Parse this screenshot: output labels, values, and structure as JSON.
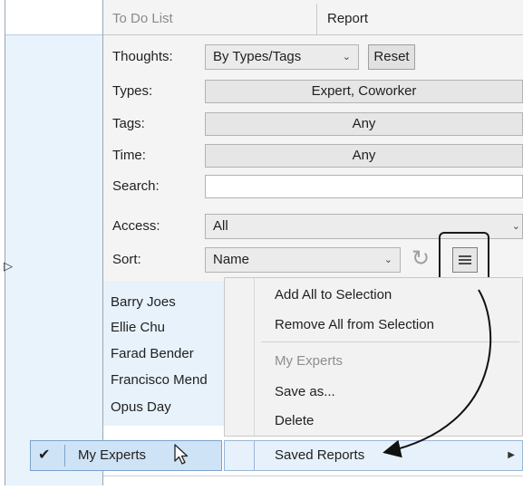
{
  "tabs": {
    "todo": "To Do List",
    "report": "Report"
  },
  "thoughts": {
    "label": "Thoughts:",
    "value": "By Types/Tags",
    "reset": "Reset"
  },
  "types": {
    "label": "Types:",
    "value": "Expert, Coworker"
  },
  "tags": {
    "label": "Tags:",
    "value": "Any"
  },
  "time": {
    "label": "Time:",
    "value": "Any"
  },
  "search": {
    "label": "Search:",
    "value": ""
  },
  "access": {
    "label": "Access:",
    "value": "All"
  },
  "sort": {
    "label": "Sort:",
    "value": "Name"
  },
  "people": [
    "Barry Joes",
    "Ellie Chu",
    "Farad Bender",
    "Francisco Mend",
    "Opus Day"
  ],
  "menu": {
    "add_all": "Add All to Selection",
    "remove_all": "Remove All from Selection",
    "my_experts": "My Experts",
    "save_as": "Save as...",
    "delete": "Delete",
    "saved_reports": "Saved Reports"
  },
  "saved_report_item": "My Experts",
  "colors": {
    "accent": "#cfe3f6",
    "panel": "#f4f4f4",
    "list_bg": "#e7f2fb"
  },
  "icons": [
    "refresh-icon",
    "hamburger-menu-icon",
    "checkmark-icon",
    "submenu-arrow-icon",
    "mouse-cursor-icon",
    "curved-arrow-annotation"
  ]
}
